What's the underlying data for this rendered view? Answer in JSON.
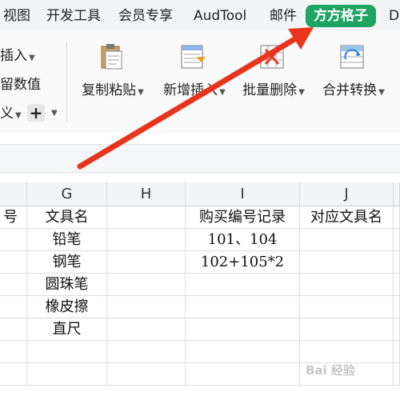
{
  "tabs": [
    "视图",
    "开发工具",
    "会员专享",
    "AudTool",
    "邮件",
    "方方格子",
    "DI"
  ],
  "ribbon": {
    "left_partial": [
      "插入",
      "留数值",
      "义"
    ],
    "buttons": [
      {
        "label": "复制粘贴",
        "icon": "paste-icon"
      },
      {
        "label": "新增插入",
        "icon": "insert-icon"
      },
      {
        "label": "批量删除",
        "icon": "delete-icon"
      },
      {
        "label": "合并转换",
        "icon": "merge-convert-icon"
      }
    ],
    "plus_label": "+"
  },
  "sheet": {
    "columns": [
      "",
      "G",
      "H",
      "I",
      "J"
    ],
    "rows": [
      [
        "号",
        "文具名",
        "",
        "购买编号记录",
        "对应文具名"
      ],
      [
        "",
        "铅笔",
        "",
        "101、104",
        ""
      ],
      [
        "",
        "钢笔",
        "",
        "102+105*2",
        ""
      ],
      [
        "",
        "圆珠笔",
        "",
        "",
        ""
      ],
      [
        "",
        "橡皮擦",
        "",
        "",
        ""
      ],
      [
        "",
        "直尺",
        "",
        "",
        ""
      ],
      [
        "",
        "",
        "",
        "",
        ""
      ],
      [
        "",
        "",
        "",
        "",
        ""
      ]
    ]
  },
  "colors": {
    "active_tab": "#1fa463",
    "arrow": "#e8341c"
  },
  "watermark": "Bai 经验"
}
